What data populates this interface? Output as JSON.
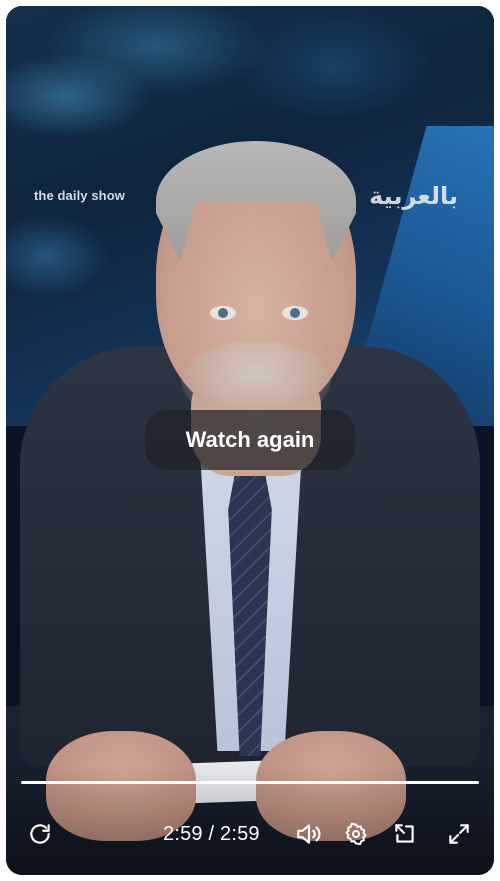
{
  "video": {
    "watermark_left": "the daily show",
    "watermark_right": "بالعربية"
  },
  "overlay": {
    "watch_again_label": "Watch again"
  },
  "progress": {
    "fraction": 1.0
  },
  "controls": {
    "current_time": "2:59",
    "separator": "/",
    "duration": "2:59",
    "icons": [
      "replay-icon",
      "volume-icon",
      "settings-icon",
      "picture-in-picture-icon",
      "fullscreen-icon"
    ]
  }
}
